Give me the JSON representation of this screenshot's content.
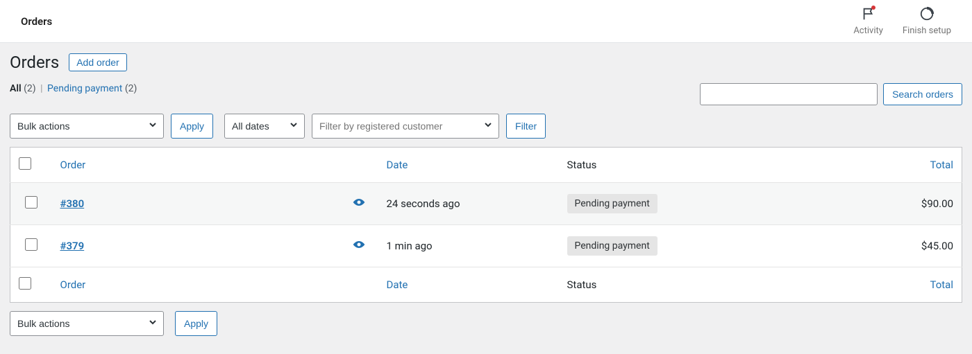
{
  "topbar": {
    "title": "Orders",
    "activity_label": "Activity",
    "finish_label": "Finish setup"
  },
  "page": {
    "title": "Orders",
    "add_order_label": "Add order"
  },
  "filters_tabs": {
    "all_label": "All",
    "all_count": "(2)",
    "separator": "|",
    "pending_label": "Pending payment",
    "pending_count": "(2)"
  },
  "search": {
    "button_label": "Search orders"
  },
  "bulk": {
    "selected": "Bulk actions",
    "apply_label": "Apply"
  },
  "date_filter": {
    "selected": "All dates"
  },
  "customer_filter": {
    "placeholder": "Filter by registered customer"
  },
  "filter_button_label": "Filter",
  "table": {
    "headers": {
      "order": "Order",
      "date": "Date",
      "status": "Status",
      "total": "Total"
    },
    "rows": [
      {
        "id": "#380",
        "date": "24 seconds ago",
        "status": "Pending payment",
        "total": "$90.00"
      },
      {
        "id": "#379",
        "date": "1 min ago",
        "status": "Pending payment",
        "total": "$45.00"
      }
    ]
  }
}
